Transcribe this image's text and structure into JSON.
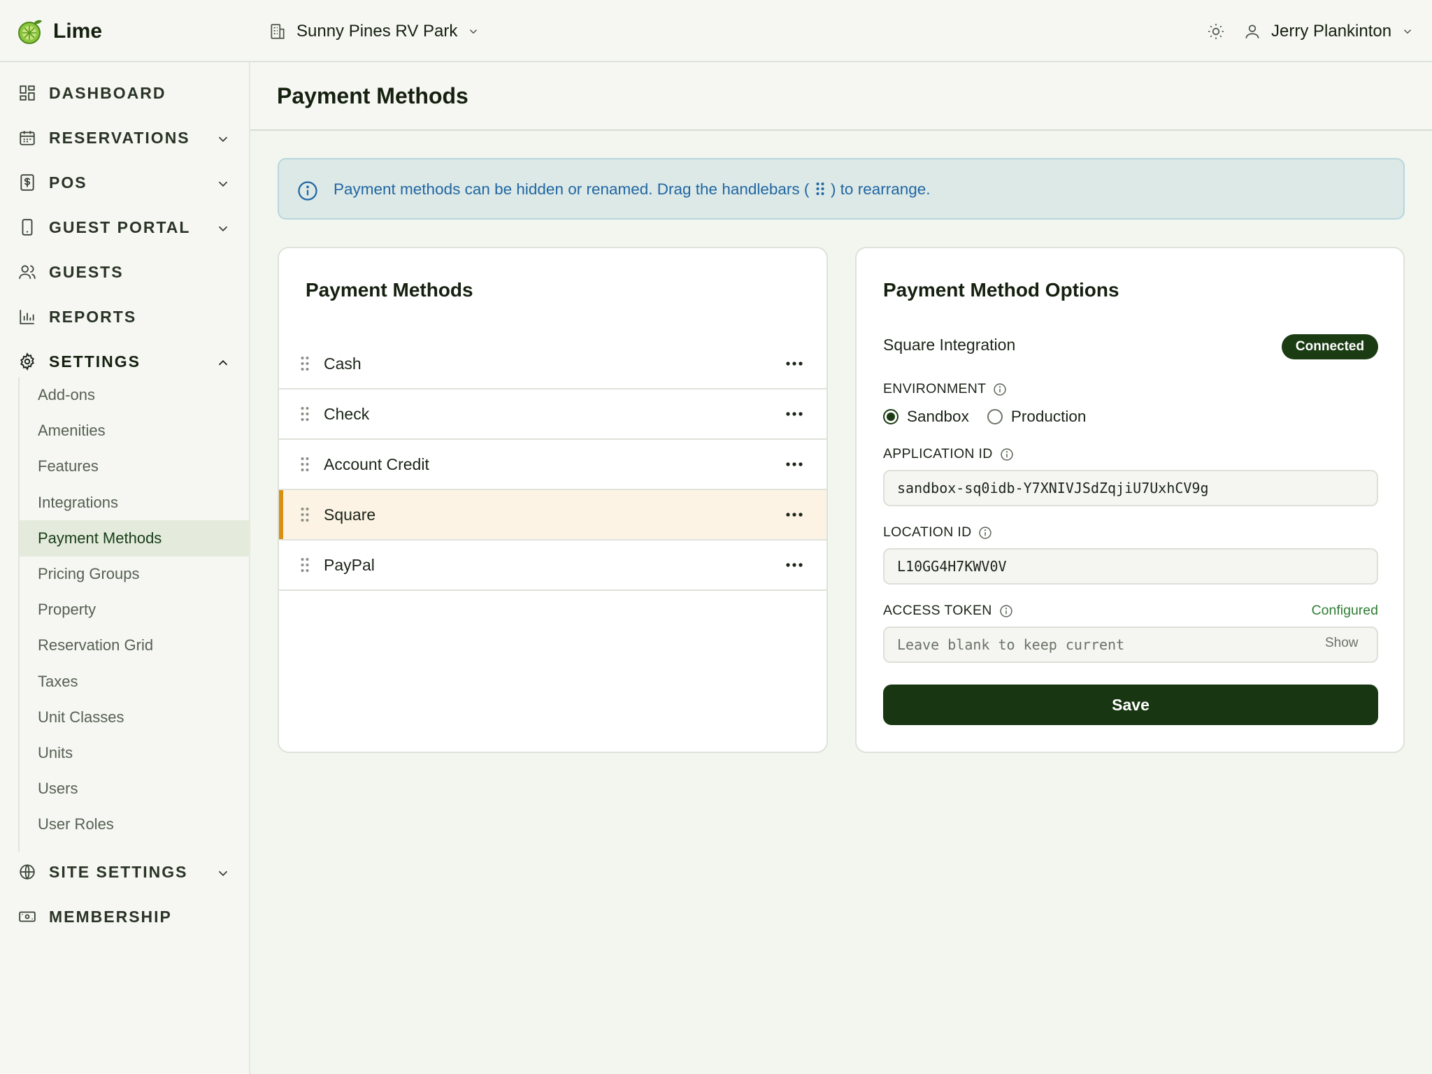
{
  "app": {
    "name": "Lime"
  },
  "header": {
    "property": "Sunny Pines RV Park",
    "user": "Jerry Plankinton"
  },
  "sidebar": {
    "items": [
      {
        "label": "DASHBOARD",
        "icon": "dashboard-icon"
      },
      {
        "label": "RESERVATIONS",
        "icon": "calendar-icon"
      },
      {
        "label": "POS",
        "icon": "pos-icon"
      },
      {
        "label": "GUEST PORTAL",
        "icon": "phone-icon"
      },
      {
        "label": "GUESTS",
        "icon": "users-icon"
      },
      {
        "label": "REPORTS",
        "icon": "bar-chart-icon"
      },
      {
        "label": "SETTINGS",
        "icon": "gear-icon"
      },
      {
        "label": "SITE SETTINGS",
        "icon": "globe-icon"
      },
      {
        "label": "MEMBERSHIP",
        "icon": "membership-card-icon"
      }
    ],
    "settings_sub": [
      "Add-ons",
      "Amenities",
      "Features",
      "Integrations",
      "Payment Methods",
      "Pricing Groups",
      "Property",
      "Reservation Grid",
      "Taxes",
      "Unit Classes",
      "Units",
      "Users",
      "User Roles"
    ],
    "active_sub": "Payment Methods"
  },
  "page": {
    "title": "Payment Methods",
    "info_before": "Payment methods can be hidden or renamed. Drag the handlebars (",
    "info_after": ") to rearrange."
  },
  "methods": {
    "title": "Payment Methods",
    "items": [
      "Cash",
      "Check",
      "Account Credit",
      "Square",
      "PayPal"
    ],
    "selected": "Square"
  },
  "options": {
    "title": "Payment Method Options",
    "integration_label": "Square Integration",
    "status": "Connected",
    "environment_label": "ENVIRONMENT",
    "env_options": [
      "Sandbox",
      "Production"
    ],
    "env_selected": "Sandbox",
    "app_id_label": "APPLICATION ID",
    "app_id_value": "sandbox-sq0idb-Y7XNIVJSdZqjiU7UxhCV9g",
    "location_id_label": "LOCATION ID",
    "location_id_value": "L10GG4H7KWV0V",
    "token_label": "ACCESS TOKEN",
    "token_status": "Configured",
    "token_placeholder": "Leave blank to keep current",
    "show_label": "Show",
    "save_label": "Save"
  },
  "colors": {
    "accent": "#173611",
    "selected_bar": "#d98f12",
    "info_text": "#2166a3",
    "configured": "#2e7d32"
  }
}
